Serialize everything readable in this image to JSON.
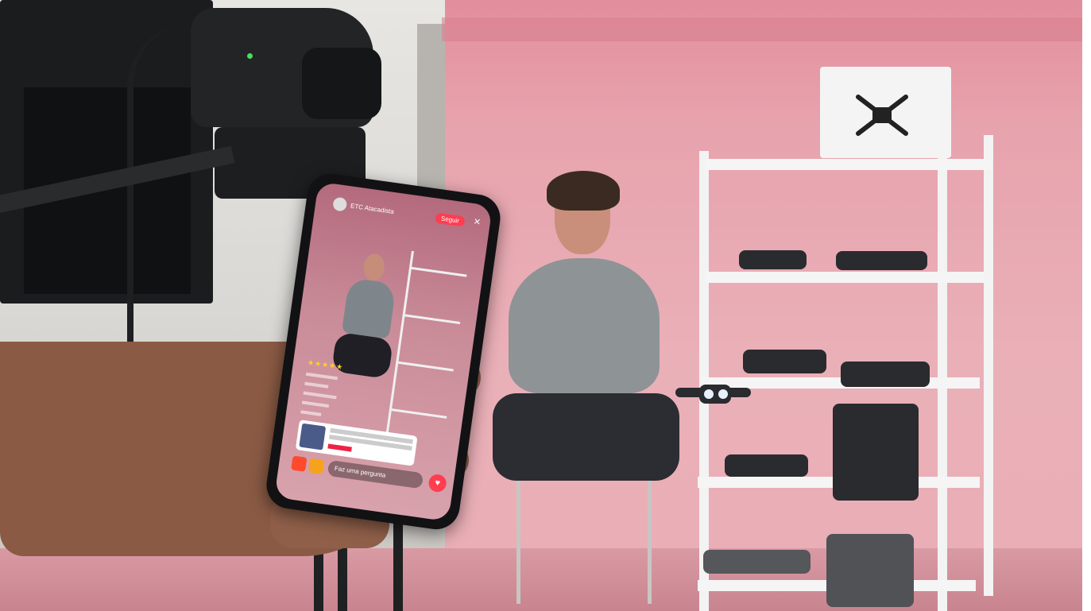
{
  "photo": {
    "description_hidden": "",
    "phone_app": {
      "shop_name": "ETC Atacadista",
      "follow_label": "Seguir",
      "close_icon": "close-icon",
      "stars": "★★★★★",
      "comments": [
        "",
        "",
        "",
        "",
        ""
      ],
      "product": {
        "title": "",
        "price": ""
      },
      "ask_label": "Faz uma pergunta",
      "like_icon": "heart-icon"
    },
    "colors": {
      "backdrop": "#e9adb5",
      "accent_red": "#ff3d4f"
    }
  }
}
